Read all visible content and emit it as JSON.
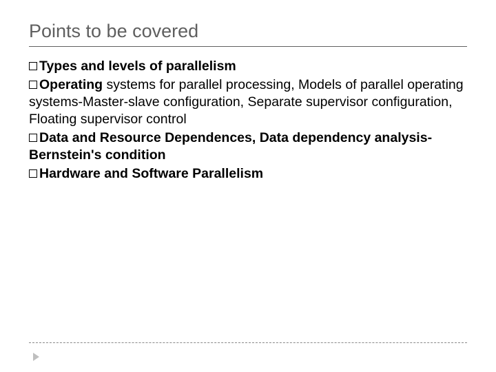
{
  "title": "Points to be covered",
  "items": {
    "b1": {
      "lead": "Types",
      "rest": " and levels of parallelism"
    },
    "b2": {
      "lead": "Operating",
      "rest": " systems for parallel processing, Models of parallel operating systems-Master-slave configuration, Separate supervisor configuration, Floating supervisor control"
    },
    "b3": {
      "lead": "Data",
      "rest": " and Resource Dependences, Data dependency analysis-Bernstein's condition"
    },
    "b4": {
      "lead": "Hardware",
      "rest": " and Software Parallelism"
    }
  }
}
